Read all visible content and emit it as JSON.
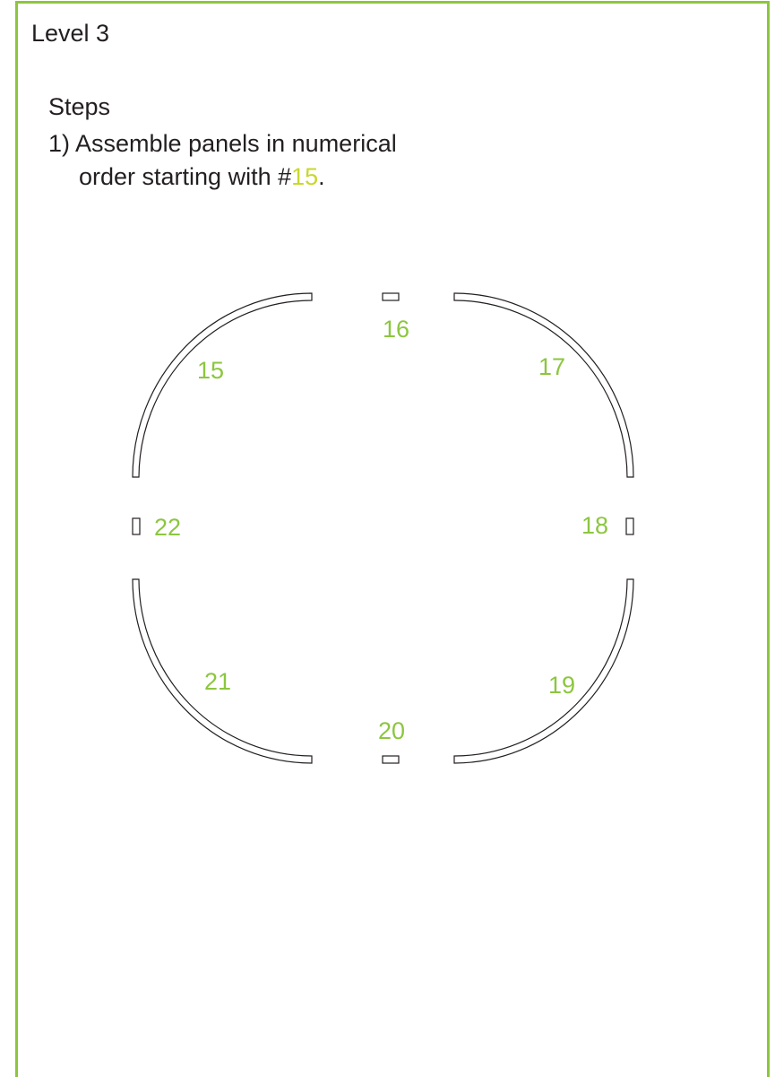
{
  "title": "Level 3",
  "steps_heading": "Steps",
  "step1": {
    "number": "1)",
    "line1": "Assemble panels in numerical",
    "line2_prefix": "order starting with #",
    "line2_highlight": "15",
    "line2_suffix": "."
  },
  "panels": {
    "p15": "15",
    "p16": "16",
    "p17": "17",
    "p18": "18",
    "p19": "19",
    "p20": "20",
    "p21": "21",
    "p22": "22"
  },
  "colors": {
    "frame": "#8cc63f",
    "label_green": "#8cc63f",
    "highlight": "#c9d72a",
    "text": "#231f20"
  }
}
